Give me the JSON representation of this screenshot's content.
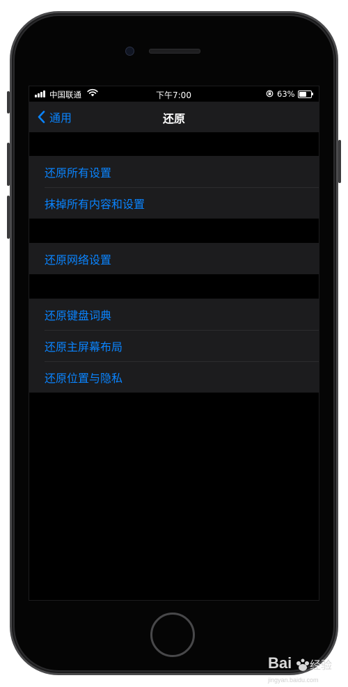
{
  "status_bar": {
    "carrier": "中国联通",
    "time": "下午7:00",
    "battery_percent": "63%",
    "battery_level": 0.63
  },
  "nav": {
    "back_label": "通用",
    "title": "还原"
  },
  "groups": [
    {
      "items": [
        "还原所有设置",
        "抹掉所有内容和设置"
      ]
    },
    {
      "items": [
        "还原网络设置"
      ]
    },
    {
      "items": [
        "还原键盘词典",
        "还原主屏幕布局",
        "还原位置与隐私"
      ]
    }
  ],
  "watermark": {
    "url": "jingyan.baidu.com"
  },
  "colors": {
    "accent": "#0a84ff",
    "background": "#000000",
    "cell": "#1c1c1e"
  }
}
